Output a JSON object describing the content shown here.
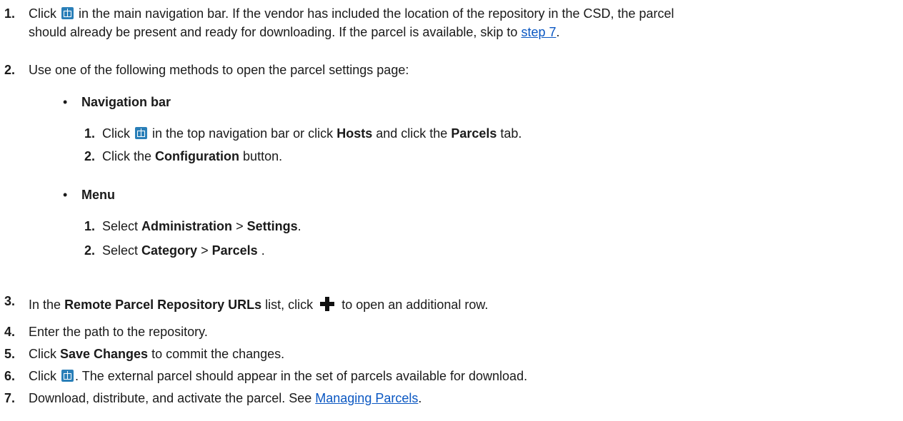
{
  "steps": {
    "s1": {
      "num": "1.",
      "t1": "Click",
      "t2": "in the main navigation bar. If the vendor has included the location of the repository in the CSD, the parcel",
      "t3": "should already be present and ready for downloading. If the parcel is available, skip to",
      "link": "step 7",
      "t4": "."
    },
    "s2": {
      "num": "2.",
      "text": "Use one of the following methods to open the parcel settings page:"
    },
    "s3": {
      "num": "3.",
      "t1": "In the",
      "b1": "Remote Parcel Repository URLs",
      "t2": "list, click",
      "t3": "to open an additional row."
    },
    "s4": {
      "num": "4.",
      "text": "Enter the path to the repository."
    },
    "s5": {
      "num": "5.",
      "t1": "Click",
      "b1": "Save Changes",
      "t2": "to commit the changes."
    },
    "s6": {
      "num": "6.",
      "t1": "Click",
      "t2": ". The external parcel should appear in the set of parcels available for download."
    },
    "s7": {
      "num": "7.",
      "t1": "Download, distribute, and activate the parcel. See",
      "link": "Managing Parcels",
      "t2": "."
    }
  },
  "methods": {
    "nav": {
      "bullet": "•",
      "title": "Navigation bar",
      "a": {
        "num": "1.",
        "t1": "Click",
        "t2": "in the top navigation bar or click",
        "b1": "Hosts",
        "t3": "and click the",
        "b2": "Parcels",
        "t4": "tab."
      },
      "b": {
        "num": "2.",
        "t1": "Click the",
        "b1": "Configuration",
        "t2": "button."
      }
    },
    "menu": {
      "bullet": "•",
      "title": "Menu",
      "a": {
        "num": "1.",
        "t1": "Select",
        "b1": "Administration",
        "sep": ">",
        "b2": "Settings",
        "t2": "."
      },
      "b": {
        "num": "2.",
        "t1": "Select",
        "b1": "Category",
        "sep": ">",
        "b2": "Parcels",
        "t2": "."
      }
    }
  },
  "icons": {
    "parcel": "parcel-icon",
    "plus": "plus-icon"
  },
  "colors": {
    "link": "#0a57c2",
    "icon": "#2a7fb8"
  }
}
